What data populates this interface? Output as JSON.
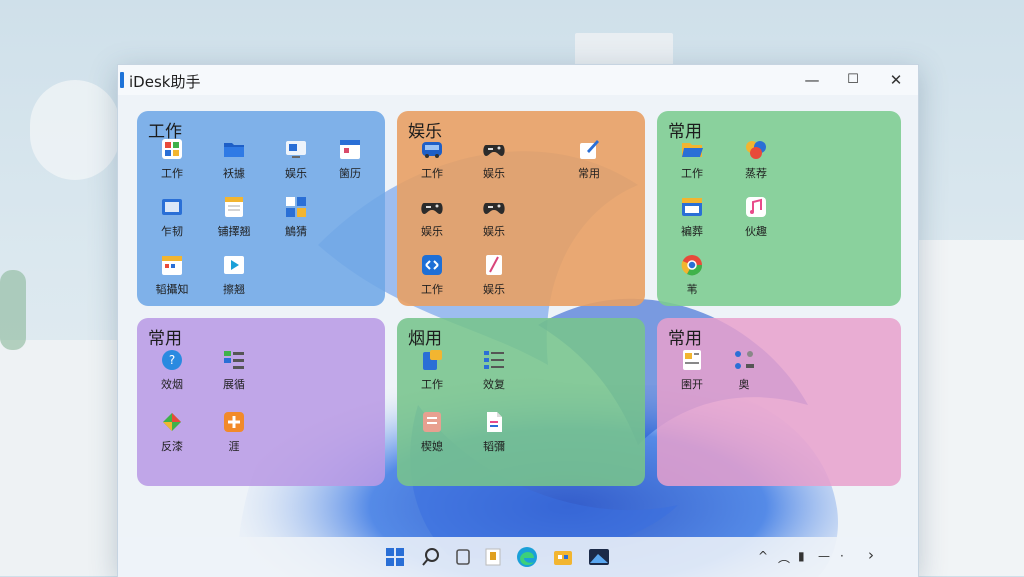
{
  "window": {
    "title": "iDesk助手",
    "minimize": "—",
    "maximize": "☐",
    "close": "✕"
  },
  "groups": [
    {
      "title": "工作",
      "apps": [
        {
          "label": "工作",
          "icon": "office-icon"
        },
        {
          "label": "袄據",
          "icon": "folder-icon"
        },
        {
          "label": "娱乐",
          "icon": "display-icon"
        },
        {
          "label": "箘历",
          "icon": "calendar-icon"
        },
        {
          "label": "乍韧",
          "icon": "photo-icon"
        },
        {
          "label": "铺擇翘",
          "icon": "notes-icon"
        },
        {
          "label": "鵤猜",
          "icon": "network-icon"
        },
        {
          "label": "韬攝知",
          "icon": "calendar-grid-icon"
        },
        {
          "label": "擦翘",
          "icon": "player-icon"
        }
      ]
    },
    {
      "title": "娱乐",
      "apps": [
        {
          "label": "工作",
          "icon": "bus-icon"
        },
        {
          "label": "娱乐",
          "icon": "gamepad-icon"
        },
        {
          "label": "常用",
          "icon": "edit-icon"
        },
        {
          "label": "娱乐",
          "icon": "gamepad-icon"
        },
        {
          "label": "娱乐",
          "icon": "gamepad-icon"
        },
        {
          "label": "工作",
          "icon": "remote-icon"
        },
        {
          "label": "娱乐",
          "icon": "sketch-icon"
        }
      ]
    },
    {
      "title": "常用",
      "apps": [
        {
          "label": "工作",
          "icon": "folder-open-icon"
        },
        {
          "label": "蒸荐",
          "icon": "palette-icon"
        },
        {
          "label": "褊葬",
          "icon": "window-icon"
        },
        {
          "label": "伙趣",
          "icon": "music-icon"
        },
        {
          "label": "苇",
          "icon": "chrome-icon"
        }
      ]
    },
    {
      "title": "常用",
      "apps": [
        {
          "label": "效烟",
          "icon": "help-icon"
        },
        {
          "label": "展循",
          "icon": "list-icon"
        },
        {
          "label": "反漆",
          "icon": "gift-icon"
        },
        {
          "label": "涯",
          "icon": "plus-icon"
        }
      ]
    },
    {
      "title": "烟用",
      "apps": [
        {
          "label": "工作",
          "icon": "clipboard-icon"
        },
        {
          "label": "效复",
          "icon": "checklist-icon"
        },
        {
          "label": "楔媳",
          "icon": "document-icon"
        },
        {
          "label": "韬彌",
          "icon": "file-icon"
        }
      ]
    },
    {
      "title": "常用",
      "apps": [
        {
          "label": "圉开",
          "icon": "news-icon"
        },
        {
          "label": "奥",
          "icon": "apps-icon"
        }
      ]
    }
  ],
  "taskbar": {
    "items": [
      "start-icon",
      "search-icon",
      "taskview-icon",
      "file-explorer-icon",
      "edge-icon",
      "store-icon",
      "photos-icon"
    ],
    "tray": {
      "chevron": "^",
      "wifi": "︵",
      "battery": "▮",
      "dash": "—",
      "dot": "·",
      "arrow": "›"
    }
  },
  "colors": {
    "work": "#6fa7e6",
    "fun": "#e8a368",
    "common": "#7ccc8f",
    "purple": "#b99be5",
    "green": "#86c999",
    "pink": "#e8a4cf"
  }
}
